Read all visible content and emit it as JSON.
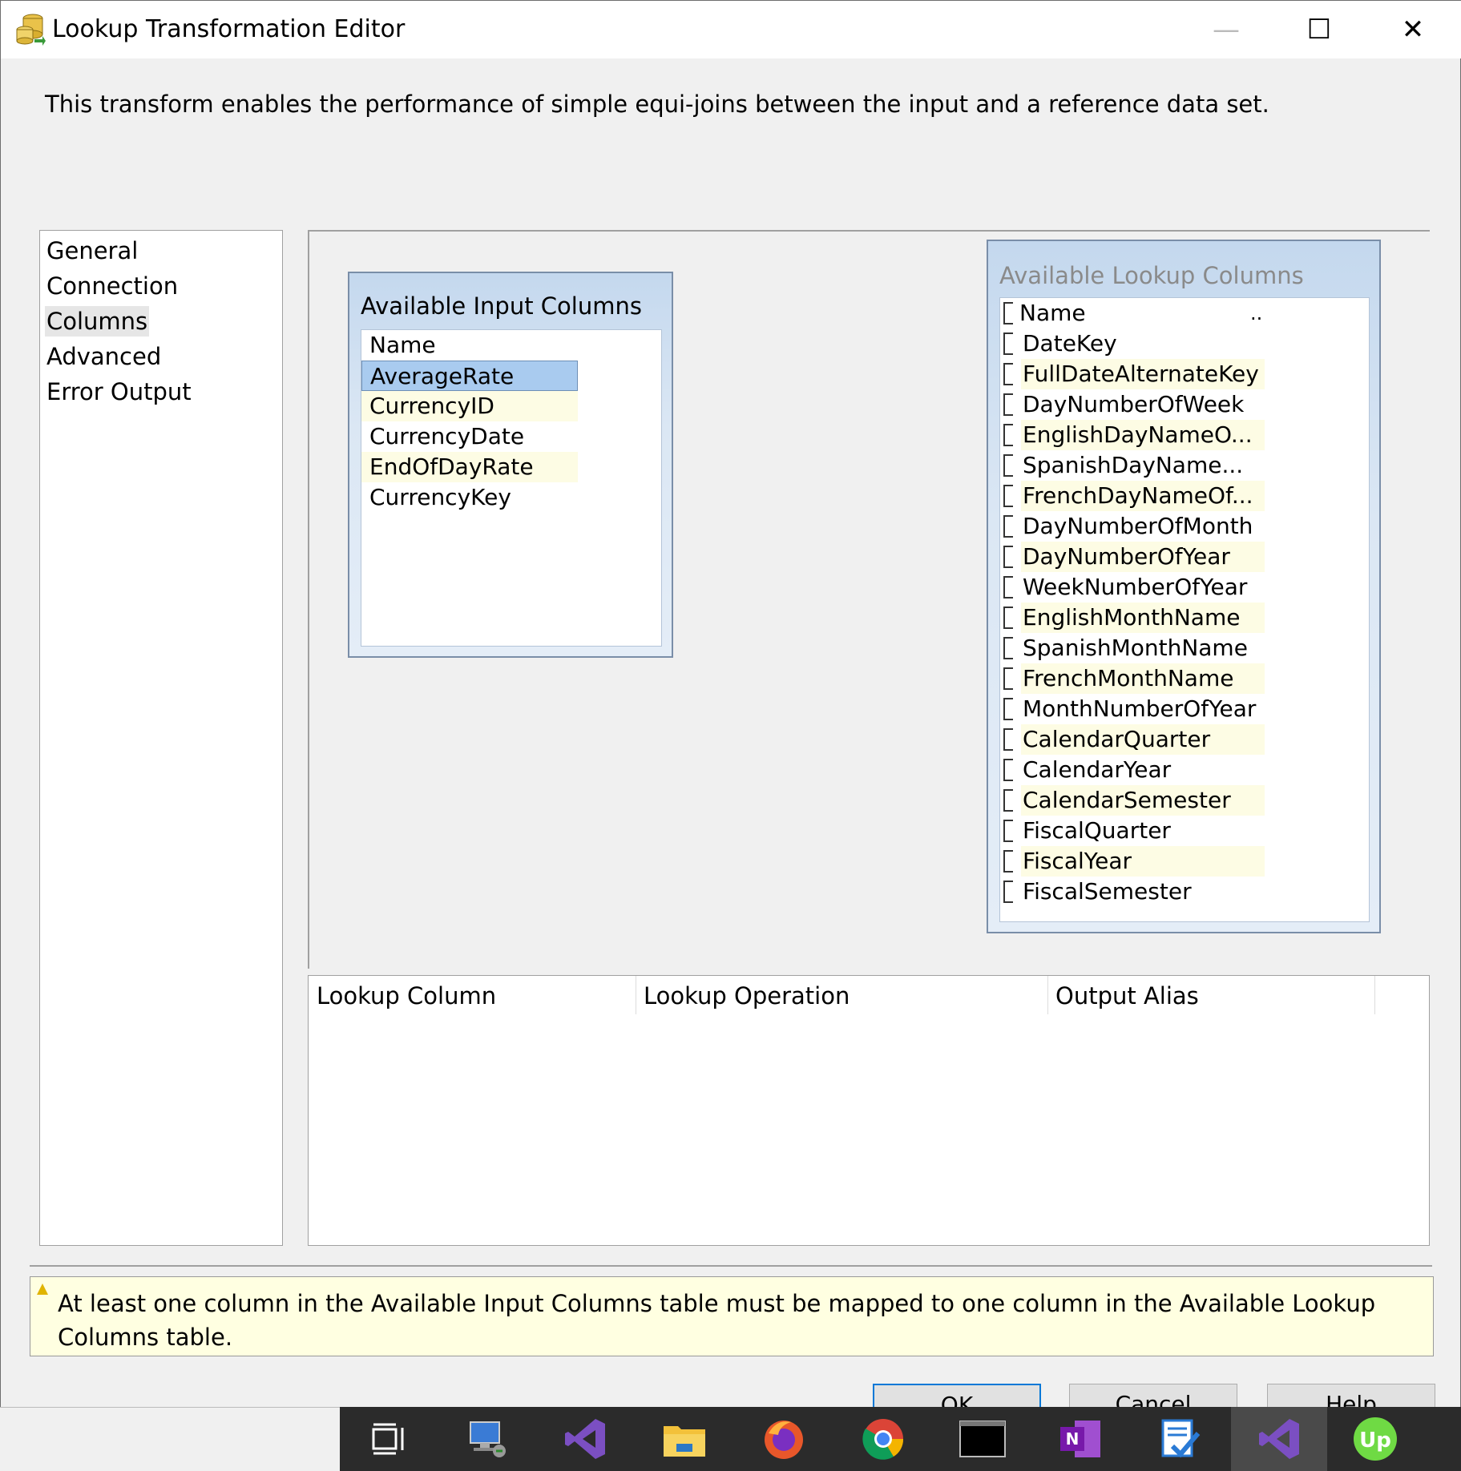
{
  "window": {
    "title": "Lookup Transformation Editor",
    "minimize_glyph": "—",
    "maximize_glyph": "☐",
    "close_glyph": "✕"
  },
  "description": "This transform enables the performance of simple equi-joins between the input and a reference data set.",
  "nav": {
    "items": [
      {
        "label": "General"
      },
      {
        "label": "Connection"
      },
      {
        "label": "Columns",
        "selected": true
      },
      {
        "label": "Advanced"
      },
      {
        "label": "Error Output"
      }
    ]
  },
  "input_table": {
    "title": "Available Input Columns",
    "header": "Name",
    "rows": [
      "AverageRate",
      "CurrencyID",
      "CurrencyDate",
      "EndOfDayRate",
      "CurrencyKey"
    ],
    "selected": "AverageRate"
  },
  "lookup_table": {
    "title": "Available Lookup Columns",
    "header": "Name",
    "header_extra": "..",
    "rows": [
      "DateKey",
      "FullDateAlternateKey",
      "DayNumberOfWeek",
      "EnglishDayNameO...",
      "SpanishDayName...",
      "FrenchDayNameOf...",
      "DayNumberOfMonth",
      "DayNumberOfYear",
      "WeekNumberOfYear",
      "EnglishMonthName",
      "SpanishMonthName",
      "FrenchMonthName",
      "MonthNumberOfYear",
      "CalendarQuarter",
      "CalendarYear",
      "CalendarSemester",
      "FiscalQuarter",
      "FiscalYear",
      "FiscalSemester"
    ]
  },
  "grid": {
    "columns": [
      "Lookup Column",
      "Lookup Operation",
      "Output Alias"
    ]
  },
  "warning": {
    "text": "At least one column in the Available Input Columns table must be mapped to one column in the Available Lookup Columns table."
  },
  "buttons": {
    "ok": "OK",
    "cancel": "Cancel",
    "help": "Help"
  },
  "taskbar": {
    "icons": [
      "task-view-icon",
      "remote-desktop-icon",
      "visual-studio-icon",
      "file-explorer-icon",
      "firefox-icon",
      "chrome-icon",
      "terminal-icon",
      "onenote-icon",
      "todo-icon",
      "visual-studio-icon-active",
      "upwork-icon"
    ]
  },
  "colors": {
    "selection": "#a9cbef",
    "alt_row": "#fdfce4",
    "warning_bg": "#ffffe1",
    "accent": "#0078d7"
  }
}
